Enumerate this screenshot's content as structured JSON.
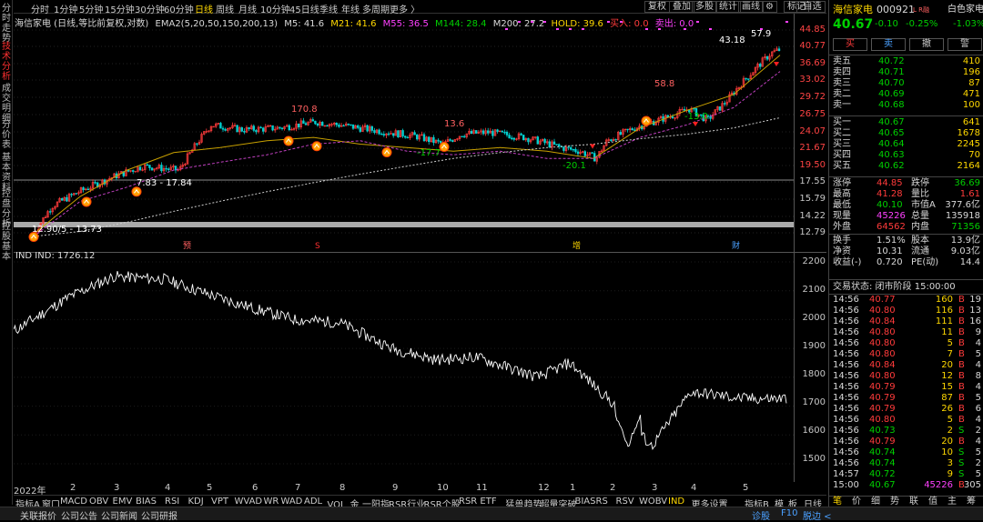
{
  "left_tabs": [
    {
      "label": "分时走势",
      "active": false
    },
    {
      "label": "技术分析",
      "active": true
    },
    {
      "label": "成交明细",
      "active": false
    },
    {
      "label": "分价表",
      "active": false
    },
    {
      "label": "基本资料",
      "active": false
    },
    {
      "label": "控盘分析",
      "active": false
    },
    {
      "label": "控股基本",
      "active": false
    }
  ],
  "periods": [
    {
      "label": "分时",
      "active": false
    },
    {
      "label": "1分钟",
      "active": false
    },
    {
      "label": "5分钟",
      "active": false
    },
    {
      "label": "15分钟",
      "active": false
    },
    {
      "label": "30分钟",
      "active": false
    },
    {
      "label": "60分钟",
      "active": false
    },
    {
      "label": "日线",
      "active": true
    },
    {
      "label": "周线",
      "active": false
    },
    {
      "label": "月线",
      "active": false
    },
    {
      "label": "10分钟",
      "active": false
    },
    {
      "label": "45日线",
      "active": false
    },
    {
      "label": "季线",
      "active": false
    },
    {
      "label": "年线",
      "active": false
    },
    {
      "label": "多周期",
      "active": false
    },
    {
      "label": "更多 〉",
      "active": false
    }
  ],
  "tools": [
    "复权",
    "叠加",
    "多股",
    "统计",
    "画线",
    "⚙",
    "标记",
    "-自选"
  ],
  "legend": {
    "title": "海信家电 (日线,等比前复权,对数)",
    "indicator": "EMA2(5,20,50,150,200,13)",
    "m5": "M5: 41.6",
    "m21": "M21: 41.6",
    "m55": "M55: 36.5",
    "m144": "M144: 28.4",
    "m200": "M200: 27.2",
    "hold": "HOLD: 39.6",
    "buy": "买入: 0.0",
    "sell": "卖出: 0.0"
  },
  "colors": {
    "m5": "#ffffff",
    "m21": "#ffd800",
    "m55": "#ff40ff",
    "m144": "#00d000",
    "m200": "#ff4040",
    "hold": "#ffd800",
    "buy": "#ff4040",
    "sell": "#ff40ff",
    "up": "#ff3b3b",
    "down": "#00d0d0"
  },
  "price_axis": [
    "44.85",
    "40.77",
    "36.69",
    "33.02",
    "29.72",
    "26.75",
    "24.07",
    "21.67",
    "19.50",
    "17.55",
    "15.79",
    "14.22",
    "12.79"
  ],
  "ind_axis": [
    "2200",
    "2100",
    "2000",
    "1900",
    "1800",
    "1700",
    "1600",
    "1500"
  ],
  "x_labels": [
    "2022年",
    "2",
    "3",
    "4",
    "5",
    "6",
    "7",
    "8",
    "9",
    "10",
    "11",
    "12",
    "1",
    "2",
    "3",
    "4",
    "5"
  ],
  "annotations": [
    "43.18",
    "57.9",
    "170.8",
    "13.6",
    "58.8",
    "-13.0",
    "-17.7",
    "-20.1",
    "7.83 - 17.84",
    "12.90/5 - 13.73"
  ],
  "events": [
    "预",
    "S",
    "增",
    "财"
  ],
  "ind_legend": "IND  IND: 1726.12",
  "ind_tabs": [
    {
      "label": "指标A",
      "active": false
    },
    {
      "label": "窗口",
      "active": false
    },
    {
      "label": "MACD",
      "active": false
    },
    {
      "label": "OBV",
      "active": false
    },
    {
      "label": "EMV",
      "active": false
    },
    {
      "label": "BIAS",
      "active": false
    },
    {
      "label": "RSI",
      "active": false
    },
    {
      "label": "KDJ",
      "active": false
    },
    {
      "label": "VPT",
      "active": false
    },
    {
      "label": "WVAD",
      "active": false
    },
    {
      "label": "WR",
      "active": false
    },
    {
      "label": "WAD",
      "active": false
    },
    {
      "label": "ADL",
      "active": false
    },
    {
      "label": "VOL_金",
      "active": false
    },
    {
      "label": "一阳指",
      "active": false
    },
    {
      "label": "RSR行业",
      "active": false
    },
    {
      "label": "RSR个股",
      "active": false
    },
    {
      "label": "RSR ETF",
      "active": false
    },
    {
      "label": "猛兽趋势",
      "active": false
    },
    {
      "label": "超量突破",
      "active": false
    },
    {
      "label": "BIASRS",
      "active": false
    },
    {
      "label": "RSV",
      "active": false
    },
    {
      "label": "WOBV",
      "active": false
    },
    {
      "label": "IND",
      "active": true
    },
    {
      "label": "更多",
      "active": false
    },
    {
      "label": "设置",
      "active": false
    }
  ],
  "ind_tabs_right": [
    "指标B",
    "模",
    "板"
  ],
  "ind_tabs_far": "日线",
  "bottom_bar": [
    "关联报价",
    "公司公告",
    "公司新闻",
    "公司研报"
  ],
  "bottom_right": [
    "诊股",
    "F10",
    "脱边 <"
  ],
  "quote": {
    "name": "海信家电",
    "code": "000921",
    "badge": "L R融",
    "price": "40.67",
    "change": "-0.10",
    "pct": "-0.25%",
    "sector": "白色家电",
    "sector_pct": "-1.03%",
    "buy_btn": "买",
    "sell_btn": "卖",
    "cancel_btn": "撤",
    "alert_btn": "警",
    "asks": [
      {
        "label": "卖五",
        "price": "40.72",
        "vol": "410"
      },
      {
        "label": "卖四",
        "price": "40.71",
        "vol": "196"
      },
      {
        "label": "卖三",
        "price": "40.70",
        "vol": "87"
      },
      {
        "label": "卖二",
        "price": "40.69",
        "vol": "471"
      },
      {
        "label": "卖一",
        "price": "40.68",
        "vol": "100"
      }
    ],
    "bids": [
      {
        "label": "买一",
        "price": "40.67",
        "vol": "641"
      },
      {
        "label": "买二",
        "price": "40.65",
        "vol": "1678"
      },
      {
        "label": "买三",
        "price": "40.64",
        "vol": "2245"
      },
      {
        "label": "买四",
        "price": "40.63",
        "vol": "70"
      },
      {
        "label": "买五",
        "price": "40.62",
        "vol": "2164"
      }
    ],
    "stats": [
      [
        "涨停",
        "44.85",
        "跌停",
        "36.69"
      ],
      [
        "最高",
        "41.28",
        "量比",
        "1.61"
      ],
      [
        "最低",
        "40.10",
        "市值A",
        "377.6亿"
      ],
      [
        "现量",
        "45226",
        "总量",
        "135918"
      ],
      [
        "外盘",
        "64562",
        "内盘",
        "71356"
      ],
      [
        "换手",
        "1.51%",
        "股本",
        "13.9亿"
      ],
      [
        "净资",
        "10.31",
        "流通",
        "9.03亿"
      ],
      [
        "收益(-)",
        "0.720",
        "PE(动)",
        "14.4"
      ]
    ],
    "status": "交易状态: 闭市阶段 15:00:00",
    "ticks": [
      [
        "14:56",
        "40.77",
        "160",
        "B",
        "19"
      ],
      [
        "14:56",
        "40.80",
        "116",
        "B",
        "13"
      ],
      [
        "14:56",
        "40.84",
        "111",
        "B",
        "16"
      ],
      [
        "14:56",
        "40.80",
        "11",
        "B",
        "9"
      ],
      [
        "14:56",
        "40.80",
        "5",
        "B",
        "4"
      ],
      [
        "14:56",
        "40.80",
        "7",
        "B",
        "5"
      ],
      [
        "14:56",
        "40.84",
        "20",
        "B",
        "4"
      ],
      [
        "14:56",
        "40.80",
        "12",
        "B",
        "8"
      ],
      [
        "14:56",
        "40.79",
        "15",
        "B",
        "4"
      ],
      [
        "14:56",
        "40.79",
        "87",
        "B",
        "5"
      ],
      [
        "14:56",
        "40.79",
        "26",
        "B",
        "6"
      ],
      [
        "14:56",
        "40.80",
        "5",
        "B",
        "4"
      ],
      [
        "14:56",
        "40.73",
        "2",
        "S",
        "2"
      ],
      [
        "14:56",
        "40.79",
        "20",
        "B",
        "4"
      ],
      [
        "14:56",
        "40.74",
        "10",
        "S",
        "5"
      ],
      [
        "14:56",
        "40.74",
        "3",
        "S",
        "2"
      ],
      [
        "14:57",
        "40.72",
        "9",
        "S",
        "5"
      ],
      [
        "15:00",
        "40.67",
        "45226",
        "B",
        "305"
      ]
    ],
    "tick_tabs": [
      "笔",
      "价",
      "细",
      "势",
      "联",
      "值",
      "主",
      "筹"
    ]
  },
  "chart_data": {
    "type": "line",
    "price_y_range": [
      12.79,
      44.85
    ],
    "price_series": [
      {
        "name": "EMA2",
        "x_range": [
          "2022-01",
          "2023-05"
        ],
        "approx_values": [
          13.0,
          16.5,
          19.5,
          21.8,
          22.5,
          23.5,
          24.0,
          23.0,
          22.5,
          22.0,
          22.5,
          22.0,
          21.0,
          25.5,
          28.5,
          31.5,
          40.5
        ]
      },
      {
        "name": "M55",
        "approx_values": [
          12.8,
          16.0,
          17.5,
          19.5,
          20.5,
          21.5,
          23.0,
          23.5,
          22.0,
          21.5,
          22.0,
          21.0,
          21.0,
          24.0,
          26.0,
          29.0,
          36.5
        ]
      },
      {
        "name": "M144",
        "approx_values": [
          12.8,
          13.2,
          14.0,
          15.0,
          16.0,
          17.0,
          18.0,
          19.0,
          20.0,
          21.0,
          21.8,
          22.5,
          23.0,
          23.8,
          24.5,
          25.5,
          27.2
        ]
      }
    ],
    "indicator": {
      "name": "IND",
      "y_range": [
        1500,
        2200
      ],
      "x": [
        "2022-01",
        "2022-02",
        "2022-03",
        "2022-04",
        "2022-05",
        "2022-06",
        "2022-07",
        "2022-08",
        "2022-09",
        "2022-10",
        "2022-11",
        "2022-12",
        "2023-01",
        "2023-02",
        "2023-03",
        "2023-04",
        "2023-05"
      ],
      "values": [
        1960,
        2080,
        2150,
        2140,
        2090,
        2040,
        2000,
        1990,
        1900,
        1860,
        1870,
        1800,
        1850,
        1720,
        1560,
        1750,
        1726
      ]
    }
  }
}
